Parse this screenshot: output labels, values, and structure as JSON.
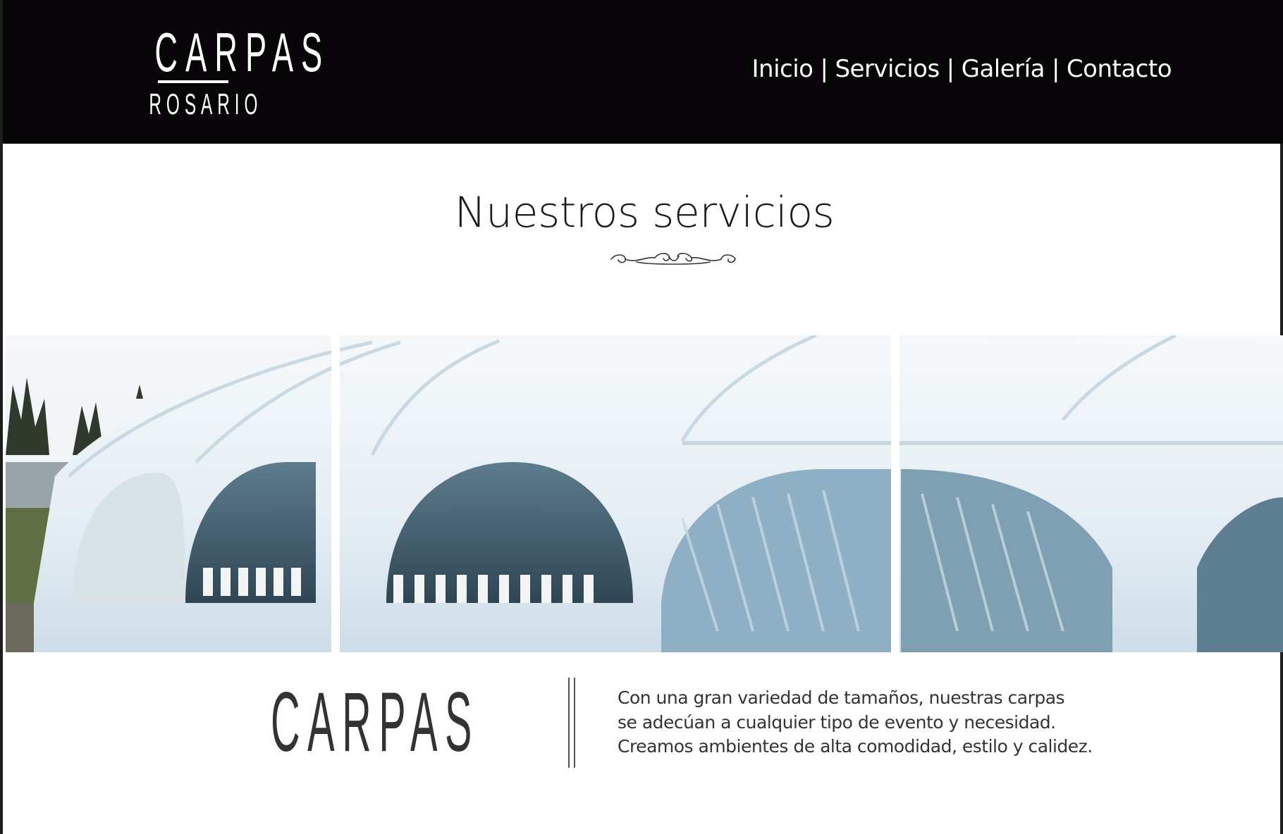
{
  "header": {
    "logo": {
      "top_text": "CARPAS",
      "bottom_text": "ROSARIO"
    },
    "nav": [
      {
        "label": "Inicio"
      },
      {
        "label": "Servicios"
      },
      {
        "label": "Galería"
      },
      {
        "label": "Contacto"
      }
    ],
    "nav_separator": "|"
  },
  "section": {
    "title": "Nuestros servicios"
  },
  "product": {
    "title": "CARPAS",
    "description_lines": [
      "Con una gran variedad de tamaños, nuestras carpas",
      "se adecúan a cualquier tipo de evento y necesidad.",
      "Creamos ambientes de alta comodidad, estilo y calidez."
    ]
  },
  "colors": {
    "header_bg": "#070507",
    "page_bg": "#ffffff",
    "text_dark": "#333333",
    "tent_white": "#eef4f8",
    "tent_shadow": "#bfd3e0"
  }
}
